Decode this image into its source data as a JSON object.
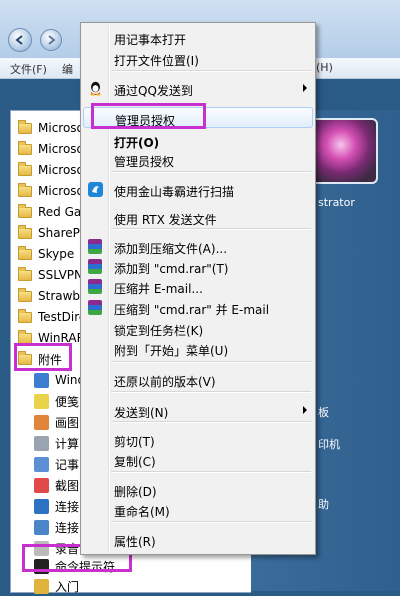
{
  "menubar": {
    "items": [
      "文件(F)",
      "编",
      "(H)"
    ]
  },
  "start_menu": {
    "programs": [
      {
        "label": "Microso",
        "type": "folder"
      },
      {
        "label": "Microso",
        "type": "folder"
      },
      {
        "label": "Microso",
        "type": "folder"
      },
      {
        "label": "Microso",
        "type": "folder"
      },
      {
        "label": "Red Gat",
        "type": "folder"
      },
      {
        "label": "SharePo",
        "type": "folder"
      },
      {
        "label": "Skype",
        "type": "folder"
      },
      {
        "label": "SSLVPN",
        "type": "folder"
      },
      {
        "label": "Strawbe",
        "type": "folder"
      },
      {
        "label": "TestDire",
        "type": "folder"
      },
      {
        "label": "WinRAR",
        "type": "folder"
      },
      {
        "label": "附件",
        "type": "folder"
      },
      {
        "label": "Wind",
        "type": "app"
      },
      {
        "label": "便笺",
        "type": "app"
      },
      {
        "label": "画图",
        "type": "app"
      },
      {
        "label": "计算",
        "type": "app"
      },
      {
        "label": "记事",
        "type": "app"
      },
      {
        "label": "截图",
        "type": "app"
      },
      {
        "label": "连接",
        "type": "app"
      },
      {
        "label": "连接",
        "type": "app"
      },
      {
        "label": "录音",
        "type": "app"
      },
      {
        "label": "命令提示符",
        "type": "app"
      },
      {
        "label": "入门",
        "type": "app"
      }
    ],
    "right_pane": {
      "user_text": "strator",
      "item1": "板",
      "item2": "印机",
      "item3": "助"
    }
  },
  "context_menu": {
    "items": [
      {
        "label": "用记事本打开",
        "style": "normal"
      },
      {
        "label": "打开文件位置(I)",
        "style": "normal"
      },
      {
        "label": "通过QQ发送到",
        "style": "normal",
        "submenu": true,
        "icon": "qq"
      },
      {
        "label": "管理员授权",
        "style": "hover"
      },
      {
        "label": "打开(O)",
        "style": "bold"
      },
      {
        "label": "管理员授权",
        "style": "normal"
      },
      {
        "label": "使用金山毒霸进行扫描",
        "style": "normal",
        "icon": "kingsoft"
      },
      {
        "label": "使用 RTX 发送文件",
        "style": "normal"
      },
      {
        "label": "添加到压缩文件(A)...",
        "style": "normal",
        "icon": "rar"
      },
      {
        "label": "添加到 \"cmd.rar\"(T)",
        "style": "normal",
        "icon": "rar"
      },
      {
        "label": "压缩并 E-mail...",
        "style": "normal",
        "icon": "rar"
      },
      {
        "label": "压缩到 \"cmd.rar\" 并 E-mail",
        "style": "normal",
        "icon": "rar"
      },
      {
        "label": "锁定到任务栏(K)",
        "style": "normal"
      },
      {
        "label": "附到「开始」菜单(U)",
        "style": "normal"
      },
      {
        "label": "还原以前的版本(V)",
        "style": "normal"
      },
      {
        "label": "发送到(N)",
        "style": "normal",
        "submenu": true
      },
      {
        "label": "剪切(T)",
        "style": "normal"
      },
      {
        "label": "复制(C)",
        "style": "normal"
      },
      {
        "label": "删除(D)",
        "style": "normal"
      },
      {
        "label": "重命名(M)",
        "style": "normal"
      },
      {
        "label": "属性(R)",
        "style": "normal"
      }
    ]
  },
  "colors": {
    "highlight": "#c72fce",
    "hover_fill": "#e1eefb",
    "menu_bg": "#f1f1f1"
  }
}
